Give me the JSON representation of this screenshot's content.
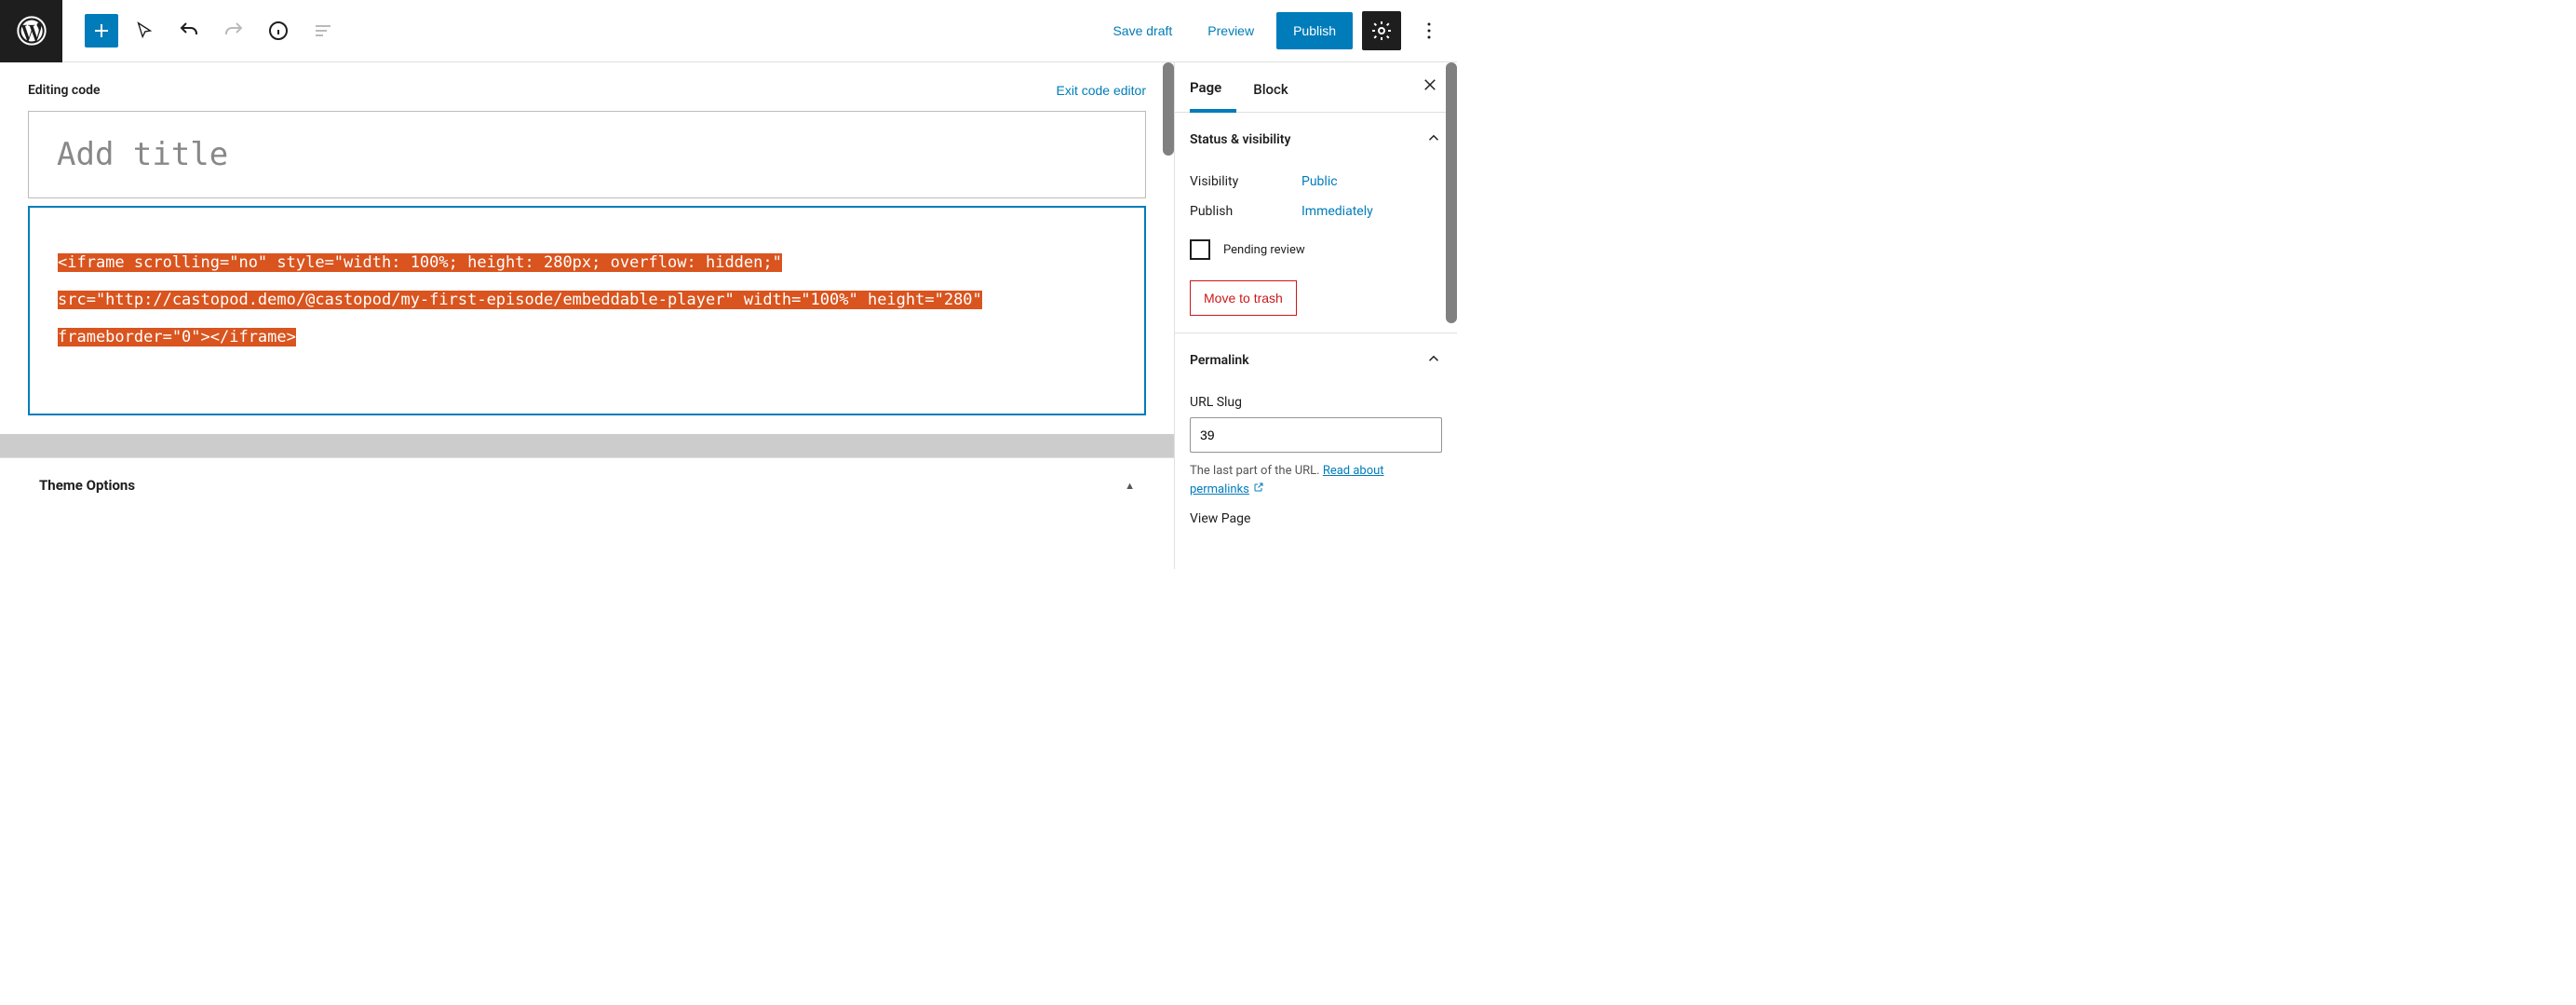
{
  "toolbar": {
    "save_draft": "Save draft",
    "preview": "Preview",
    "publish": "Publish"
  },
  "editor": {
    "editing_code_label": "Editing code",
    "exit_code_label": "Exit code editor",
    "title_placeholder": "Add title",
    "code_content": "<iframe scrolling=\"no\" style=\"width: 100%; height: 280px; overflow: hidden;\" src=\"http://castopod.demo/@castopod/my-first-episode/embeddable-player\" width=\"100%\" height=\"280\" frameborder=\"0\"></iframe>",
    "theme_options_label": "Theme Options"
  },
  "sidebar": {
    "tabs": {
      "page": "Page",
      "block": "Block"
    },
    "status": {
      "title": "Status & visibility",
      "visibility_label": "Visibility",
      "visibility_value": "Public",
      "publish_label": "Publish",
      "publish_value": "Immediately",
      "pending_review": "Pending review",
      "move_to_trash": "Move to trash"
    },
    "permalink": {
      "title": "Permalink",
      "url_slug_label": "URL Slug",
      "url_slug_value": "39",
      "help_text_prefix": "The last part of the URL. ",
      "help_link": "Read about permalinks",
      "view_page_label": "View Page"
    }
  }
}
